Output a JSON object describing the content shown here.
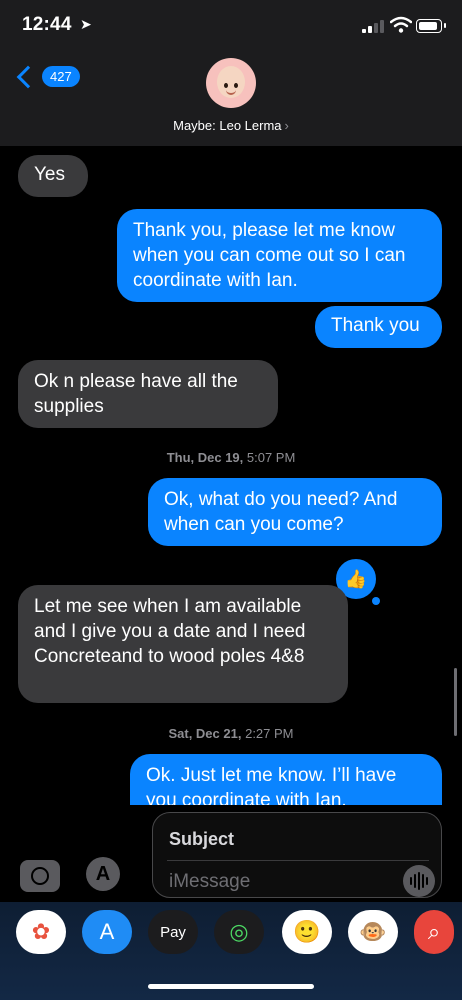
{
  "status": {
    "time": "12:44",
    "location_icon": "location-arrow-icon"
  },
  "header": {
    "back_count": "427",
    "contact_label": "Maybe: Leo Lerma",
    "contact_chevron": "›"
  },
  "messages": [
    {
      "dir": "in",
      "text": "Yes"
    },
    {
      "dir": "out",
      "text": "Thank you, please let me know when you can come out so I can coordinate with Ian."
    },
    {
      "dir": "out",
      "text": "Thank you"
    },
    {
      "dir": "in",
      "text": "Ok n please have all the supplies"
    },
    {
      "dir": "out",
      "text": "Ok, what do you need? And when can you come?"
    },
    {
      "dir": "in",
      "text": "Let me see when I am available and I give you a date and I need Concreteand to wood poles 4&8"
    },
    {
      "dir": "out",
      "text": "Ok. Just let me know. I’ll have you coordinate with Ian."
    }
  ],
  "timestamps": [
    {
      "day": "Thu, Dec 19,",
      "time": "5:07 PM"
    },
    {
      "day": "Sat, Dec 21,",
      "time": "2:27 PM"
    }
  ],
  "tapback": {
    "icon": "thumbs-up-icon",
    "glyph": "👍"
  },
  "composer": {
    "subject_placeholder": "Subject",
    "message_placeholder": "iMessage"
  },
  "app_drawer": [
    {
      "name": "photos-app-icon",
      "glyph": "✿",
      "bg": "#ffffff",
      "color": "#e8533f"
    },
    {
      "name": "app-store-icon",
      "glyph": "A",
      "bg": "#1f8cf5",
      "color": "#ffffff"
    },
    {
      "name": "apple-pay-icon",
      "glyph": "Pay",
      "bg": "#1c1c1e",
      "color": "#ffffff"
    },
    {
      "name": "activity-icon",
      "glyph": "◎",
      "bg": "#1c1c1e",
      "color": "#4cd964"
    },
    {
      "name": "memoji-icon",
      "glyph": "🙂",
      "bg": "#ffffff",
      "color": "#000000"
    },
    {
      "name": "animoji-monkey-icon",
      "glyph": "🐵",
      "bg": "#ffffff",
      "color": "#000000"
    },
    {
      "name": "web-search-icon",
      "glyph": "⌕",
      "bg": "#e8453c",
      "color": "#ffffff"
    }
  ]
}
